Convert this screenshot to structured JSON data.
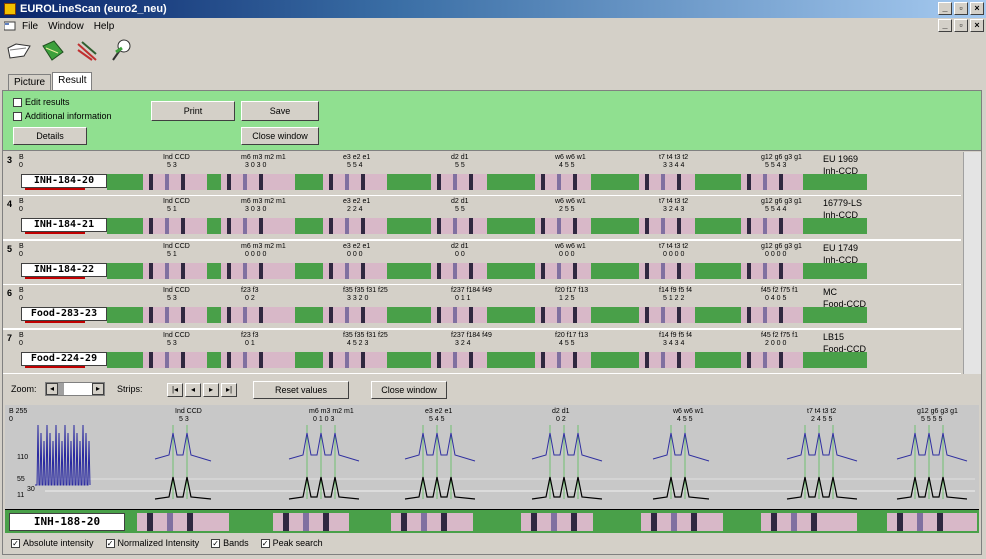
{
  "window": {
    "title": "EUROLineScan (euro2_neu)"
  },
  "menu": {
    "items": [
      "File",
      "Window",
      "Help"
    ]
  },
  "toolbar": {
    "icons": [
      "folder-open-icon",
      "green-strip-icon",
      "pen-strip-icon",
      "pin-icon"
    ]
  },
  "tabs": [
    {
      "label": "Picture"
    },
    {
      "label": "Result"
    }
  ],
  "top_panel": {
    "edit_results": "Edit results",
    "additional_info": "Additional information",
    "print": "Print",
    "save": "Save",
    "details": "Details",
    "close_window": "Close window"
  },
  "strips": [
    {
      "num": "3",
      "label": "INH-184-20",
      "meta1": "EU 1969",
      "meta2": "Inh-CCD",
      "groups": [
        [
          "Ind CCD",
          "5  3"
        ],
        [
          "m6 m3 m2 m1",
          "3  0  3  0"
        ],
        [
          "e3  e2  e1",
          "5  5  4"
        ],
        [
          "d2  d1",
          "5  5"
        ],
        [
          "w6  w6  w1",
          "4  5  5"
        ],
        [
          "t7  t4  t3  t2",
          "3  3  4  4"
        ],
        [
          "g12  g6  g3  g1",
          "5  5  4  3"
        ]
      ]
    },
    {
      "num": "4",
      "label": "INH-184-21",
      "meta1": "16779-LS",
      "meta2": "Inh-CCD",
      "groups": [
        [
          "Ind CCD",
          "5  1"
        ],
        [
          "m6 m3 m2 m1",
          "3  0  3  0"
        ],
        [
          "e3  e2  e1",
          "2  2  4"
        ],
        [
          "d2  d1",
          "5  5"
        ],
        [
          "w6  w6  w1",
          "2  5  5"
        ],
        [
          "t7  t4  t3  t2",
          "3  2  4  3"
        ],
        [
          "g12  g6  g3  g1",
          "5  5  4  4"
        ]
      ]
    },
    {
      "num": "5",
      "label": "INH-184-22",
      "meta1": "EU 1749",
      "meta2": "Inh-CCD",
      "groups": [
        [
          "Ind CCD",
          "5  1"
        ],
        [
          "m6 m3 m2 m1",
          "0  0  0  0"
        ],
        [
          "e3  e2  e1",
          "0  0  0"
        ],
        [
          "d2  d1",
          "0  0"
        ],
        [
          "w6  w6  w1",
          "0  0  0"
        ],
        [
          "t7  t4  t3  t2",
          "0  0  0  0"
        ],
        [
          "g12  g6  g3  g1",
          "0  0  0  0"
        ]
      ]
    },
    {
      "num": "6",
      "label": "Food-283-23",
      "meta1": "MC",
      "meta2": "Food-CCD",
      "groups": [
        [
          "Ind CCD",
          "5  3"
        ],
        [
          "f23  f3",
          "0  2"
        ],
        [
          "f35  f35  f31  f25",
          "3  3  2  0"
        ],
        [
          "f237 f184  f49",
          "0  1  1"
        ],
        [
          "f20  f17  f13",
          "1  2  5"
        ],
        [
          "f14  f9  f5  f4",
          "5  1  2  2"
        ],
        [
          "f45  f2  f75  f1",
          "0  4  0  5"
        ]
      ]
    },
    {
      "num": "7",
      "label": "Food-224-29",
      "meta1": "LB15",
      "meta2": "Food-CCD",
      "groups": [
        [
          "Ind CCD",
          "5  3"
        ],
        [
          "f23  f3",
          "0  1"
        ],
        [
          "f35  f35  f31  f25",
          "4  5  2  3"
        ],
        [
          "f237 f184  f49",
          "3  2  4"
        ],
        [
          "f20  f17  f13",
          "4  5  5"
        ],
        [
          "f14  f9  f5  f4",
          "3  4  3  4"
        ],
        [
          "f45  f2  f75  f1",
          "2  0  0  0"
        ]
      ]
    }
  ],
  "zoombar": {
    "zoom": "Zoom:",
    "strips": "Strips:",
    "reset": "Reset values",
    "close": "Close window"
  },
  "graph": {
    "groups": [
      [
        "Ind  CCD",
        "5    3"
      ],
      [
        "m6   m3   m2   m1",
        "0    1    0    3"
      ],
      [
        "e3    e2    e1",
        "5      4      5"
      ],
      [
        "d2    d1",
        "0      2"
      ],
      [
        "w6    w6    w1",
        "4      5      5"
      ],
      [
        "t7    t4    t3    t2",
        "2     4     5     5"
      ],
      [
        "g12   g6    g3    g1",
        "5     5     5     5"
      ]
    ],
    "y_labels": [
      "B 255",
      "0",
      "110",
      "55",
      "30",
      "11"
    ],
    "label": "INH-188-20"
  },
  "options": [
    "Absolute intensity",
    "Normalized Intensity",
    "Bands",
    "Peak search"
  ]
}
